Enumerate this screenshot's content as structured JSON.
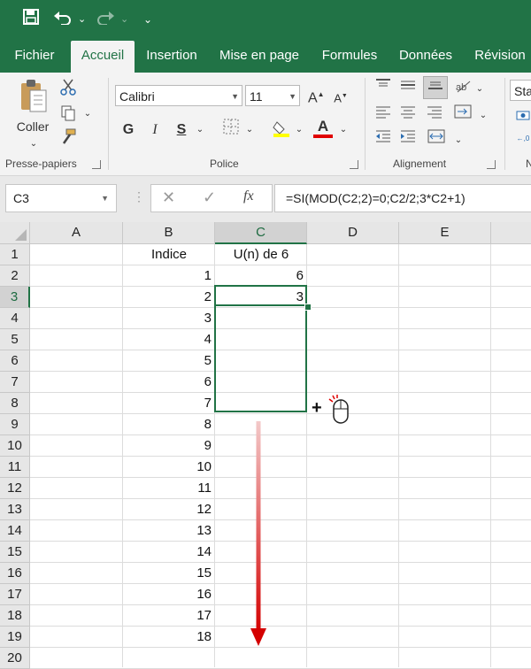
{
  "quick_access": {
    "save_icon": "save-icon",
    "undo_icon": "undo-icon",
    "redo_icon": "redo-icon",
    "customize_icon": "customize-icon"
  },
  "tabs": [
    {
      "label": "Fichier"
    },
    {
      "label": "Accueil"
    },
    {
      "label": "Insertion"
    },
    {
      "label": "Mise en page"
    },
    {
      "label": "Formules"
    },
    {
      "label": "Données"
    },
    {
      "label": "Révision"
    }
  ],
  "ribbon": {
    "clipboard": {
      "paste_label": "Coller",
      "group_label": "Presse-papiers"
    },
    "font": {
      "name": "Calibri",
      "size": "11",
      "bold": "G",
      "italic": "I",
      "underline": "S",
      "grow": "A",
      "shrink": "A",
      "font_color_letter": "A",
      "group_label": "Police"
    },
    "alignment": {
      "group_label": "Alignement"
    },
    "number": {
      "format": "Sta",
      "group_label": "N"
    }
  },
  "formula_bar": {
    "name_box": "C3",
    "fx": "fx",
    "formula": "=SI(MOD(C2;2)=0;C2/2;3*C2+1)"
  },
  "columns": [
    "A",
    "B",
    "C",
    "D",
    "E"
  ],
  "rows": [
    "1",
    "2",
    "3",
    "4",
    "5",
    "6",
    "7",
    "8",
    "9",
    "10",
    "11",
    "12",
    "13",
    "14",
    "15",
    "16",
    "17",
    "18",
    "19",
    "20"
  ],
  "cells": {
    "B1": "Indice",
    "C1": "U(n) de 6",
    "C2": "6",
    "C3": "3",
    "B_values": [
      "1",
      "2",
      "3",
      "4",
      "5",
      "6",
      "7",
      "8",
      "9",
      "10",
      "11",
      "12",
      "13",
      "14",
      "15",
      "16",
      "17",
      "18"
    ]
  },
  "colors": {
    "accent": "#217346",
    "arrow": "#e00000"
  }
}
